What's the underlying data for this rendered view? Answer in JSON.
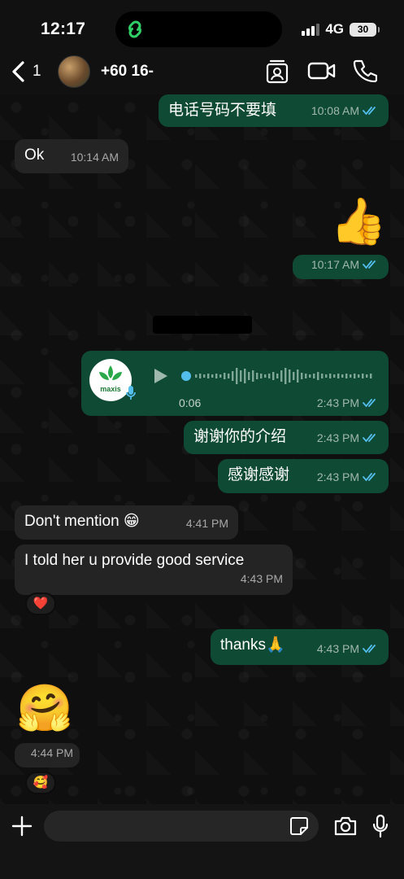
{
  "status": {
    "time": "12:17",
    "network": "4G",
    "battery": "30"
  },
  "header": {
    "back_count": "1",
    "contact_name": "+60 16-"
  },
  "messages": [
    {
      "text": "电话号码不要填",
      "time": "10:08 AM"
    },
    {
      "text": "Ok",
      "time": "10:14 AM"
    },
    {
      "emoji": "👍",
      "time": "10:17 AM"
    },
    {
      "voice_duration": "0:06",
      "time": "2:43 PM",
      "avatar_label": "maxis"
    },
    {
      "text": "谢谢你的介绍",
      "time": "2:43 PM"
    },
    {
      "text": "感谢感谢",
      "time": "2:43 PM"
    },
    {
      "text": "Don't mention 😁",
      "time": "4:41 PM"
    },
    {
      "text": "I told her u provide good service",
      "time": "4:43 PM",
      "reaction": "❤️"
    },
    {
      "text": "thanks🙏",
      "time": "4:43 PM"
    },
    {
      "emoji": "🤗",
      "time": "4:44 PM",
      "reaction": "🥰"
    }
  ],
  "composer": {
    "placeholder": ""
  },
  "colors": {
    "incoming": "#242424",
    "outgoing": "#0f4a35",
    "read_ticks": "#53bdeb"
  },
  "icons": [
    "back-chevron-icon",
    "contact-card-icon",
    "video-call-icon",
    "phone-call-icon",
    "plus-icon",
    "sticker-icon",
    "camera-icon",
    "mic-icon",
    "play-icon",
    "read-ticks-icon"
  ]
}
